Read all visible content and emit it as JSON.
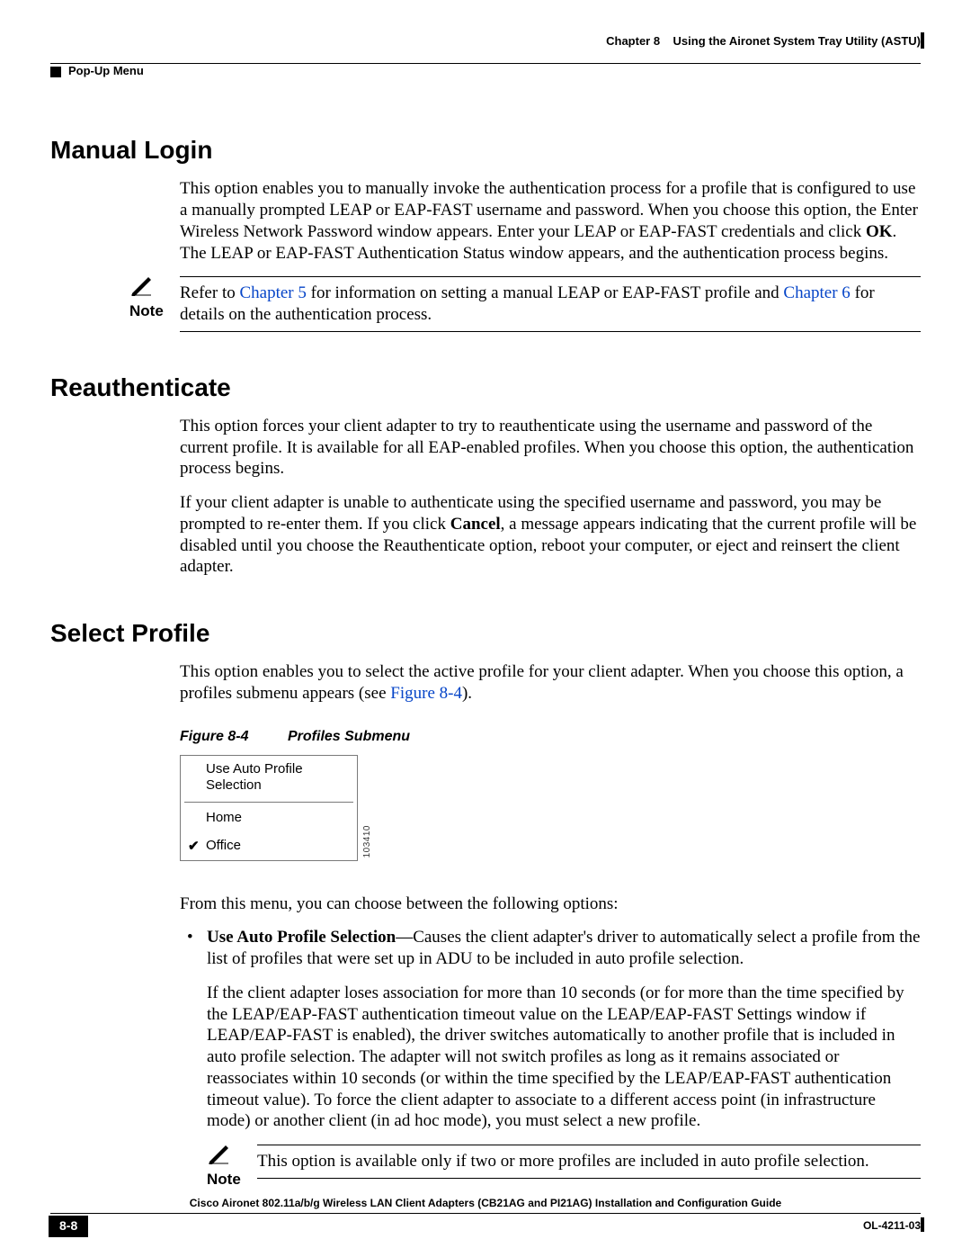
{
  "header": {
    "chapter_label": "Chapter 8",
    "chapter_title": "Using the Aironet System Tray Utility (ASTU)",
    "breadcrumb": "Pop-Up Menu"
  },
  "sections": {
    "manual_login": {
      "heading": "Manual Login",
      "p1a": "This option enables you to manually invoke the authentication process for a profile that is configured to use a manually prompted LEAP or EAP-FAST username and password. When you choose this option, the Enter Wireless Network Password window appears. Enter your LEAP or EAP-FAST credentials and click ",
      "p1b": "OK",
      "p1c": ". The LEAP or EAP-FAST Authentication Status window appears, and the authentication process begins.",
      "note_label": "Note",
      "note_a": "Refer to ",
      "note_link1": "Chapter 5",
      "note_b": " for information on setting a manual LEAP or EAP-FAST profile and ",
      "note_link2": "Chapter 6",
      "note_c": " for details on the authentication process."
    },
    "reauth": {
      "heading": "Reauthenticate",
      "p1": "This option forces your client adapter to try to reauthenticate using the username and password of the current profile. It is available for all EAP-enabled profiles. When you choose this option, the authentication process begins.",
      "p2a": "If your client adapter is unable to authenticate using the specified username and password, you may be prompted to re-enter them. If you click ",
      "p2b": "Cancel",
      "p2c": ", a message appears indicating that the current profile will be disabled until you choose the Reauthenticate option, reboot your computer, or eject and reinsert the client adapter."
    },
    "select_profile": {
      "heading": "Select Profile",
      "p1a": "This option enables you to select the active profile for your client adapter. When you choose this option, a profiles submenu appears (see ",
      "p1link": "Figure 8-4",
      "p1b": ").",
      "figure_num": "Figure 8-4",
      "figure_title": "Profiles Submenu",
      "menu": {
        "opt1": "Use Auto Profile Selection",
        "opt2": "Home",
        "opt3": "Office",
        "sidecode": "103410"
      },
      "p2": "From this menu, you can choose between the following options:",
      "bullet1_term": "Use Auto Profile Selection",
      "bullet1_rest": "—Causes the client adapter's driver to automatically select a profile from the list of profiles that were set up in ADU to be included in auto profile selection.",
      "bullet1_p2": "If the client adapter loses association for more than 10 seconds (or for more than the time specified by the LEAP/EAP-FAST authentication timeout value on the LEAP/EAP-FAST Settings window if LEAP/EAP-FAST is enabled), the driver switches automatically to another profile that is included in auto profile selection. The adapter will not switch profiles as long as it remains associated or reassociates within 10 seconds (or within the time specified by the LEAP/EAP-FAST authentication timeout value). To force the client adapter to associate to a different access point (in infrastructure mode) or another client (in ad hoc mode), you must select a new profile.",
      "note2_label": "Note",
      "note2_body": "This option is available only if two or more profiles are included in auto profile selection."
    }
  },
  "footer": {
    "title": "Cisco Aironet 802.11a/b/g Wireless LAN Client Adapters (CB21AG and PI21AG) Installation and Configuration Guide",
    "page": "8-8",
    "doccode": "OL-4211-03"
  }
}
